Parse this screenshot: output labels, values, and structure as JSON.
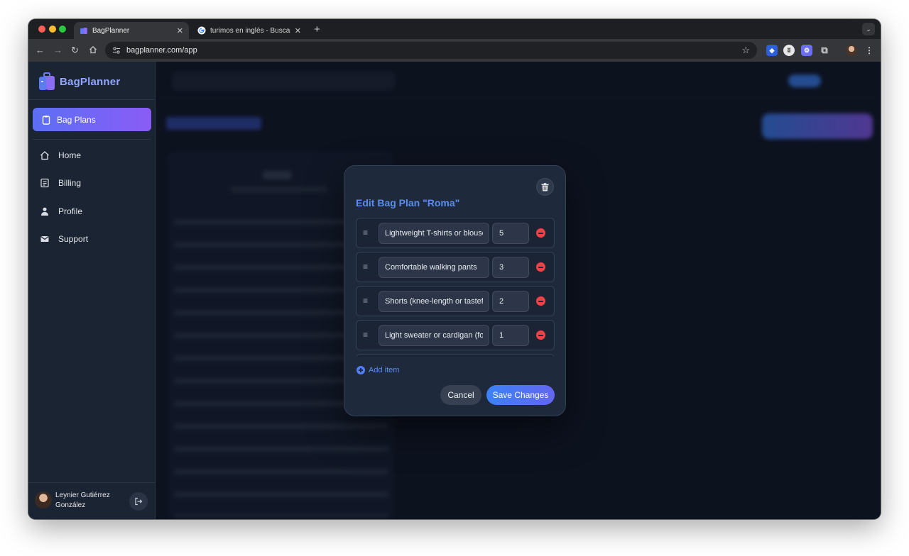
{
  "browser": {
    "tabs": [
      {
        "title": "BagPlanner",
        "active": true
      },
      {
        "title": "turimos en inglés - Buscar co",
        "active": false
      }
    ],
    "new_tab": "+",
    "url": "bagplanner.com/app"
  },
  "app": {
    "brand": "BagPlanner",
    "nav": [
      {
        "label": "Bag Plans",
        "icon": "clipboard-icon",
        "active": true
      },
      {
        "label": "Home",
        "icon": "home-icon"
      },
      {
        "label": "Billing",
        "icon": "receipt-icon"
      },
      {
        "label": "Profile",
        "icon": "person-icon"
      },
      {
        "label": "Support",
        "icon": "envelope-icon"
      }
    ],
    "user": {
      "name": "Leynier Gutiérrez González"
    }
  },
  "modal": {
    "title": "Edit Bag Plan \"Roma\"",
    "items": [
      {
        "name": "Lightweight T-shirts or blouses",
        "qty": "5"
      },
      {
        "name": "Comfortable walking pants",
        "qty": "3"
      },
      {
        "name": "Shorts (knee-length or tasteful)",
        "qty": "2"
      },
      {
        "name": "Light sweater or cardigan (for evenings)",
        "qty": "1"
      }
    ],
    "add_item": "Add item",
    "cancel": "Cancel",
    "save": "Save Changes"
  },
  "colors": {
    "accent": "#5b8def",
    "active_nav_start": "#5b6ff5",
    "active_nav_end": "#8b5cf6",
    "danger": "#ef4444"
  }
}
